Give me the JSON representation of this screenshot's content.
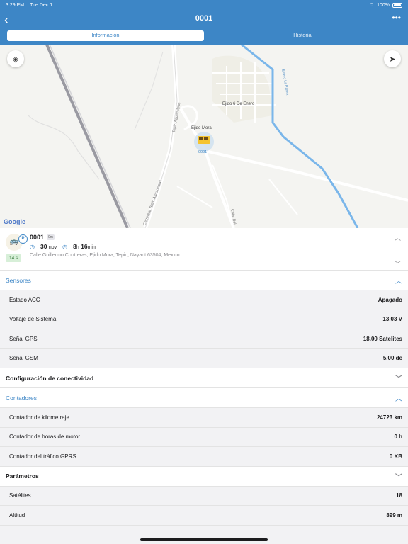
{
  "status_bar": {
    "time": "3:29 PM",
    "date": "Tue Dec 1",
    "battery": "100%"
  },
  "header": {
    "title": "0001",
    "tabs": [
      {
        "label": "Información",
        "active": true
      },
      {
        "label": "Historia",
        "active": false
      }
    ]
  },
  "map": {
    "labels": {
      "town": "Ejido Mora",
      "town2": "Ejido 6 De Enero",
      "road1": "Tepic-Aguamilpas",
      "road2": "Carretera Tepic-Aguamilpas",
      "road3": "Calle Bel",
      "river": "Estero La Palma",
      "marker": "0001",
      "attribution": "Google"
    }
  },
  "vehicle": {
    "name": "0001",
    "badge": "0m",
    "date_day": "30",
    "date_month": "nov",
    "duration_h": "8",
    "duration_m": "16",
    "h_unit": "h",
    "m_unit": "min",
    "address": "Calle Guillermo Contreras, Ejido Mora, Tepic, Nayarit 63504, Mexico",
    "since": "14 s",
    "status_icon": "P"
  },
  "sections": {
    "sensores": {
      "title": "Sensores",
      "rows": [
        {
          "label": "Estado ACC",
          "value": "Apagado"
        },
        {
          "label": "Voltaje de Sistema",
          "value": "13.03 V"
        },
        {
          "label": "Señal GPS",
          "value": "18.00 Satelites"
        },
        {
          "label": "Señal GSM",
          "value": "5.00 de"
        }
      ]
    },
    "conectividad": {
      "title": "Configuración de conectividad"
    },
    "contadores": {
      "title": "Contadores",
      "rows": [
        {
          "label": "Contador de kilometraje",
          "value": "24723 km"
        },
        {
          "label": "Contador de horas de motor",
          "value": "0 h"
        },
        {
          "label": "Contador del tráfico GPRS",
          "value": "0 KB"
        }
      ]
    },
    "parametros": {
      "title": "Parámetros",
      "rows": [
        {
          "label": "Satélites",
          "value": "18"
        },
        {
          "label": "Altitud",
          "value": "899 m"
        }
      ]
    }
  },
  "colors": {
    "accent": "#3d86c6",
    "river": "#7ab6ea",
    "status_badge_bg": "#d7efd8"
  }
}
